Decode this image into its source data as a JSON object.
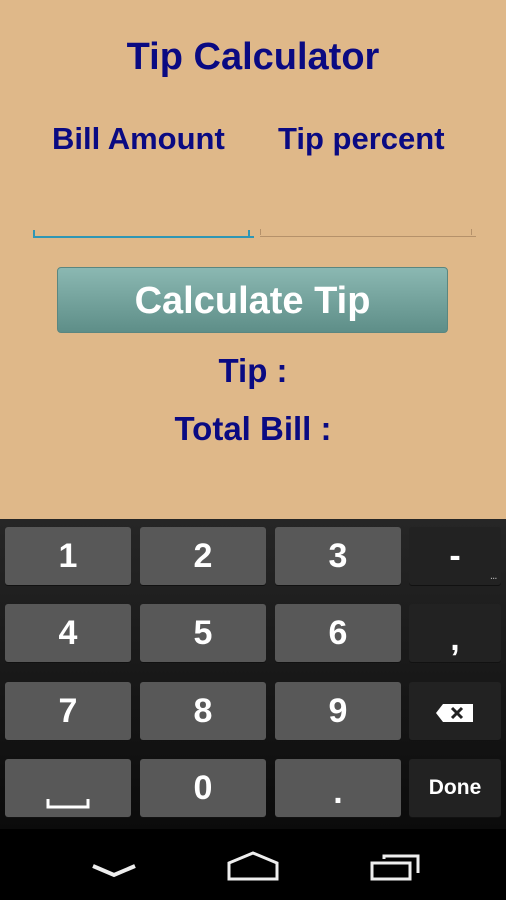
{
  "app": {
    "title": "Tip Calculator",
    "bill_label": "Bill Amount",
    "tip_label": "Tip percent",
    "bill_input": {
      "value": "",
      "placeholder": ""
    },
    "tip_input": {
      "value": "",
      "placeholder": ""
    },
    "calculate_button": "Calculate Tip",
    "tip_result": "Tip :",
    "total_result": "Total Bill :",
    "colors": {
      "background": "#dfb889",
      "text": "#0a0a82",
      "button": "#6f9f99",
      "focus_underline": "#2f96b4"
    }
  },
  "keyboard": {
    "rows": [
      [
        "1",
        "2",
        "3",
        "-"
      ],
      [
        "4",
        "5",
        "6",
        ","
      ],
      [
        "7",
        "8",
        "9",
        "backspace-icon"
      ],
      [
        "space-icon",
        "0",
        ".",
        "Done"
      ]
    ],
    "done_label": "Done",
    "more_indicator": "..."
  },
  "navbar": {
    "buttons": [
      "back-icon",
      "home-icon",
      "recents-icon"
    ]
  }
}
